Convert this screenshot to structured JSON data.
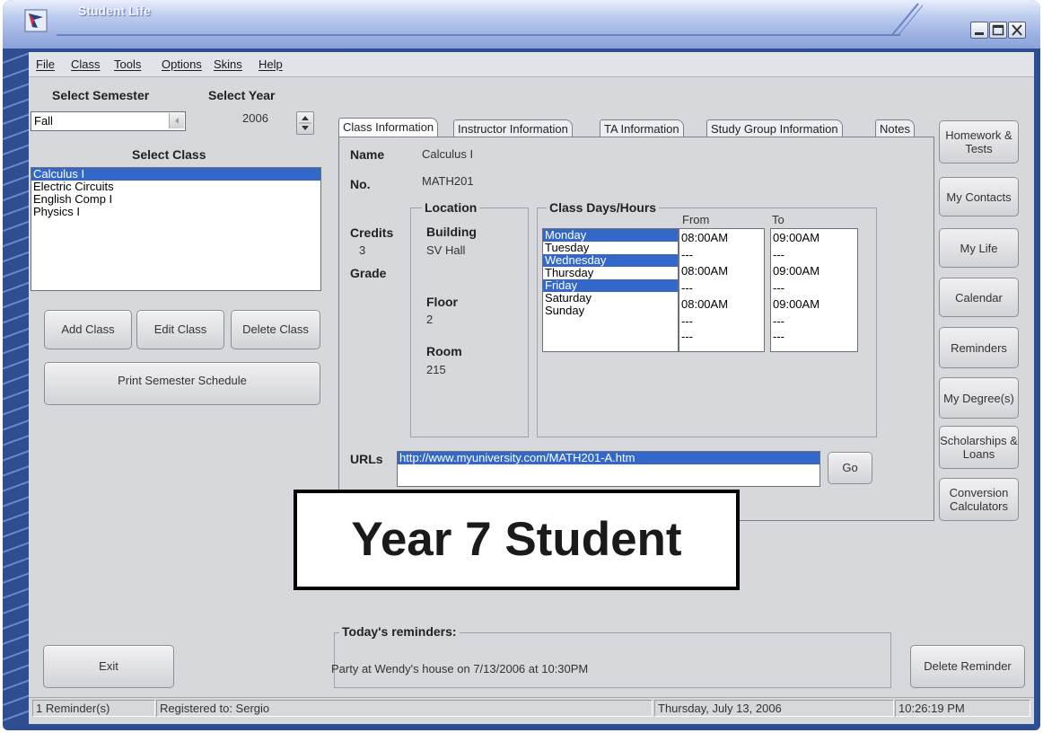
{
  "window": {
    "title": "Student Life"
  },
  "menu": [
    "File",
    "Class",
    "Tools",
    "Options",
    "Skins",
    "Help"
  ],
  "left": {
    "select_semester_label": "Select Semester",
    "select_year_label": "Select Year",
    "semester_value": "Fall",
    "year_value": "2006",
    "select_class_label": "Select Class",
    "classes": [
      "Calculus I",
      "Electric Circuits",
      "English Comp I",
      "Physics I"
    ],
    "selected_class": "Calculus I",
    "add_class": "Add Class",
    "edit_class": "Edit Class",
    "delete_class": "Delete Class",
    "print_schedule": "Print Semester Schedule",
    "exit": "Exit"
  },
  "tabs": [
    "Class Information",
    "Instructor Information",
    "TA Information",
    "Study Group Information",
    "Notes"
  ],
  "active_tab": "Class Information",
  "class_info": {
    "name_label": "Name",
    "name_value": "Calculus I",
    "no_label": "No.",
    "no_value": "MATH201",
    "credits_label": "Credits",
    "credits_value": "3",
    "grade_label": "Grade",
    "location_title": "Location",
    "building_label": "Building",
    "building_value": "SV Hall",
    "floor_label": "Floor",
    "floor_value": "2",
    "room_label": "Room",
    "room_value": "215",
    "days_title": "Class Days/Hours",
    "from_label": "From",
    "to_label": "To",
    "days": [
      {
        "day": "Monday",
        "from": "08:00AM",
        "to": "09:00AM",
        "selected": true
      },
      {
        "day": "Tuesday",
        "from": "---",
        "to": "---",
        "selected": false
      },
      {
        "day": "Wednesday",
        "from": "08:00AM",
        "to": "09:00AM",
        "selected": true
      },
      {
        "day": "Thursday",
        "from": "---",
        "to": "---",
        "selected": false
      },
      {
        "day": "Friday",
        "from": "08:00AM",
        "to": "09:00AM",
        "selected": true
      },
      {
        "day": "Saturday",
        "from": "---",
        "to": "---",
        "selected": false
      },
      {
        "day": "Sunday",
        "from": "---",
        "to": "---",
        "selected": false
      }
    ],
    "urls_label": "URLs",
    "url": "http://www.myuniversity.com/MATH201-A.htm",
    "go": "Go"
  },
  "right_buttons": [
    "Homework & Tests",
    "My Contacts",
    "My Life",
    "Calendar",
    "Reminders",
    "My Degree(s)",
    "Scholarships & Loans",
    "Conversion Calculators"
  ],
  "overlay_text": "Year 7 Student",
  "reminders": {
    "title": "Today's reminders:",
    "text": "Party at Wendy's house on 7/13/2006 at 10:30PM",
    "delete": "Delete Reminder"
  },
  "status": {
    "reminders": "1 Reminder(s)",
    "registered": "Registered to: Sergio",
    "date": "Thursday, July 13, 2006",
    "time": "10:26:19 PM"
  },
  "colors": {
    "title_gradient_top": "#e9eefb",
    "frame": "#2f4e92",
    "selection": "#3468c8",
    "client_bg": "#d7d8dc"
  }
}
